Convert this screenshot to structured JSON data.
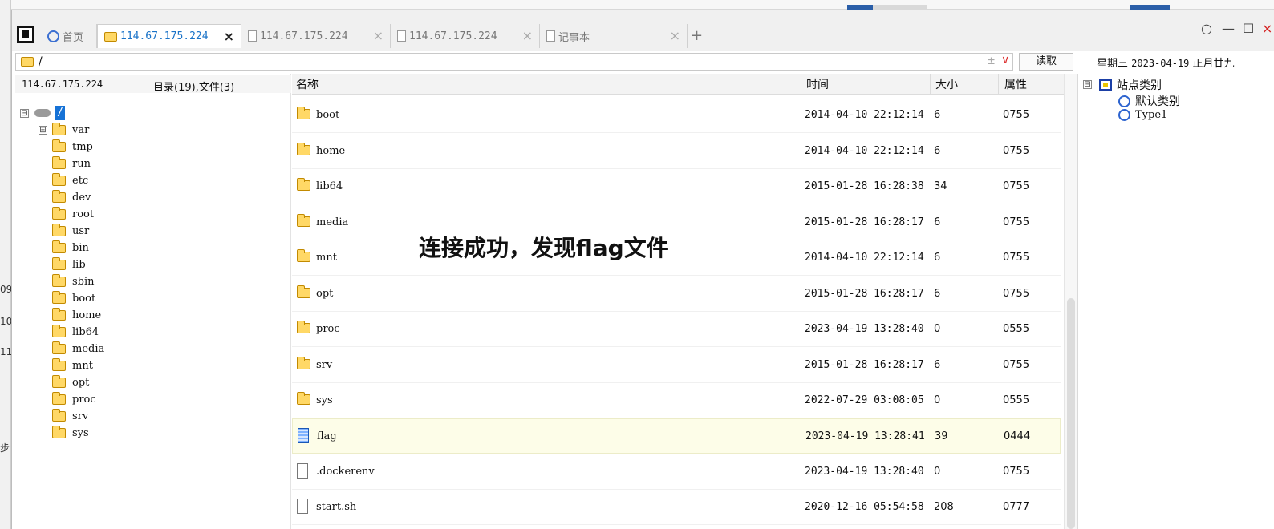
{
  "background": {
    "left_fragments": [
      "09",
      "10",
      "11",
      "步"
    ]
  },
  "tabs": [
    {
      "label": "首页",
      "icon": "globe-icon",
      "active": false
    },
    {
      "label": "114.67.175.224",
      "icon": "folder-icon",
      "active": true
    },
    {
      "label": "114.67.175.224",
      "icon": "document-icon",
      "active": false
    },
    {
      "label": "114.67.175.224",
      "icon": "document-icon",
      "active": false
    },
    {
      "label": "记事本",
      "icon": "notepad-icon",
      "active": false
    }
  ],
  "tab_close_symbol": "×",
  "add_tab_symbol": "+",
  "window_controls": {
    "circle": "○",
    "minimize": "—",
    "maximize": "☐",
    "close": "×"
  },
  "address": {
    "path": "/",
    "plus_minus": "±",
    "dropdown": "∨"
  },
  "read_button": "读取",
  "date": {
    "weekday": "星期三",
    "date": "2023-04-19",
    "lunar": "正月廿九"
  },
  "tree": {
    "host": "114.67.175.224",
    "count": "目录(19),文件(3)",
    "root": "/",
    "expander_collapse": "⊟",
    "expander_expand": "⊞",
    "items": [
      "var",
      "tmp",
      "run",
      "etc",
      "dev",
      "root",
      "usr",
      "bin",
      "lib",
      "sbin",
      "boot",
      "home",
      "lib64",
      "media",
      "mnt",
      "opt",
      "proc",
      "srv",
      "sys"
    ]
  },
  "list": {
    "headers": {
      "name": "名称",
      "time": "时间",
      "size": "大小",
      "attr": "属性"
    },
    "rows": [
      {
        "name": "boot",
        "time": "2014-04-10 22:12:14",
        "size": "6",
        "attr": "0755",
        "type": "folder"
      },
      {
        "name": "home",
        "time": "2014-04-10 22:12:14",
        "size": "6",
        "attr": "0755",
        "type": "folder"
      },
      {
        "name": "lib64",
        "time": "2015-01-28 16:28:38",
        "size": "34",
        "attr": "0755",
        "type": "folder"
      },
      {
        "name": "media",
        "time": "2015-01-28 16:28:17",
        "size": "6",
        "attr": "0755",
        "type": "folder"
      },
      {
        "name": "mnt",
        "time": "2014-04-10 22:12:14",
        "size": "6",
        "attr": "0755",
        "type": "folder"
      },
      {
        "name": "opt",
        "time": "2015-01-28 16:28:17",
        "size": "6",
        "attr": "0755",
        "type": "folder"
      },
      {
        "name": "proc",
        "time": "2023-04-19 13:28:40",
        "size": "0",
        "attr": "0555",
        "type": "folder"
      },
      {
        "name": "srv",
        "time": "2015-01-28 16:28:17",
        "size": "6",
        "attr": "0755",
        "type": "folder"
      },
      {
        "name": "sys",
        "time": "2022-07-29 03:08:05",
        "size": "0",
        "attr": "0555",
        "type": "folder"
      },
      {
        "name": "flag",
        "time": "2023-04-19 13:28:41",
        "size": "39",
        "attr": "0444",
        "type": "flag-file"
      },
      {
        "name": ".dockerenv",
        "time": "2023-04-19 13:28:40",
        "size": "0",
        "attr": "0755",
        "type": "file"
      },
      {
        "name": "start.sh",
        "time": "2020-12-16 05:54:58",
        "size": "208",
        "attr": "0777",
        "type": "file"
      }
    ]
  },
  "overlay_text": "连接成功，发现flag文件",
  "categories": {
    "root": "站点类别",
    "expander": "⊟",
    "items": [
      "默认类别",
      "Type1"
    ]
  },
  "colors": {
    "accent": "#1a73c8",
    "selection": "#1672d6",
    "folder": "#ffd866",
    "selected_row": "#fdfde8"
  }
}
